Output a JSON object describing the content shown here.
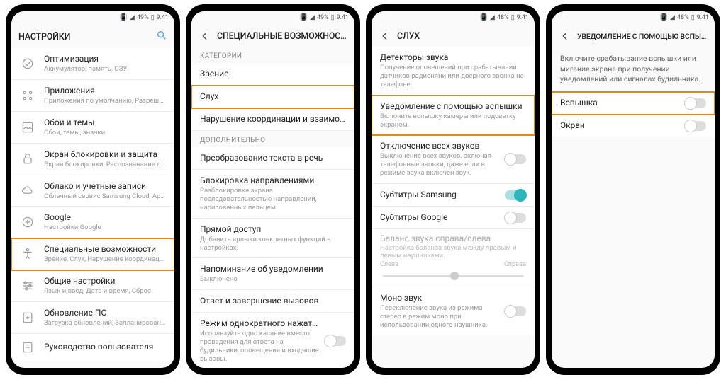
{
  "status": {
    "signal": "▮▮▮▮",
    "battery_pct": "49%",
    "battery_pct2": "48%",
    "time": "9:41"
  },
  "p1": {
    "title": "НАСТРОЙКИ",
    "items": [
      {
        "label": "Оптимизация",
        "sub": "Аккумулятор, память, ОЗУ"
      },
      {
        "label": "Приложения",
        "sub": "Приложения по умолчанию, Разрешения…"
      },
      {
        "label": "Обои и темы",
        "sub": "Обои, темы, значки"
      },
      {
        "label": "Экран блокировки и защита",
        "sub": "Экран блокировки, Распознавание лица…"
      },
      {
        "label": "Облако и учетные записи",
        "sub": "Облачный сервис Samsung Cloud, Архив…"
      },
      {
        "label": "Google",
        "sub": "Настройки Google"
      },
      {
        "label": "Специальные возможности",
        "sub": "Зрение, Слух, Нарушение координации и…"
      },
      {
        "label": "Общие настройки",
        "sub": "Язык и ввод, Дата и время, Сброс"
      },
      {
        "label": "Обновление ПО",
        "sub": "Загрузка обновлений, Запланированное…"
      },
      {
        "label": "Руководство пользователя",
        "sub": ""
      }
    ]
  },
  "p2": {
    "title": "СПЕЦИАЛЬНЫЕ ВОЗМОЖНОСТИ",
    "cat_label": "КАТЕГОРИИ",
    "extra_label": "ДОПОЛНИТЕЛЬНО",
    "categories": [
      {
        "label": "Зрение"
      },
      {
        "label": "Слух"
      },
      {
        "label": "Нарушение координации и взаимод…"
      }
    ],
    "extras": [
      {
        "label": "Преобразование текста в речь",
        "sub": ""
      },
      {
        "label": "Блокировка направлениями",
        "sub": "Разблокировка экрана последовательностью направлений, нарисованных пальцем."
      },
      {
        "label": "Прямой доступ",
        "sub": "Добавить ярлыки конкретных функций в настройках."
      },
      {
        "label": "Напоминание об уведомлении",
        "sub": "Выключено"
      },
      {
        "label": "Ответ и завершение вызовов",
        "sub": ""
      },
      {
        "label": "Режим однократного нажатия",
        "sub": "Используйте одно касание вместо проведения для ответа на будильники, оповещения и входящие вызовы."
      }
    ]
  },
  "p3": {
    "title": "СЛУХ",
    "items": [
      {
        "label": "Детекторы звука",
        "sub": "Получение оповещений при срабатывании датчиков радионяни или дверного звонка на телефоне."
      },
      {
        "label": "Уведомление с помощью вспышки",
        "sub": "Включите вспышку камеры или подсветку экраном."
      },
      {
        "label": "Отключение всех звуков",
        "sub": "Выключение всех звуков, включая телефонные звонки, даже если в режиме звука включен звук."
      },
      {
        "label": "Субтитры Samsung"
      },
      {
        "label": "Субтитры Google"
      }
    ],
    "balance": {
      "label": "Баланс звука справа/слева",
      "sub": "Настройка баланса звука между правым и левым наушниками.",
      "left": "Слева",
      "right": "Справа"
    },
    "mono": {
      "label": "Моно звук",
      "sub": "Переключение звука из режима стерео в режим моно при использовании одного наушника."
    }
  },
  "p4": {
    "title": "УВЕДОМЛЕНИЕ С ПОМОЩЬЮ ВСПЫШКИ",
    "desc": "Включите срабатывание вспышки или мигание экрана при получении уведомлений или сигналах будильника.",
    "opt1": "Вспышка",
    "opt2": "Экран"
  }
}
